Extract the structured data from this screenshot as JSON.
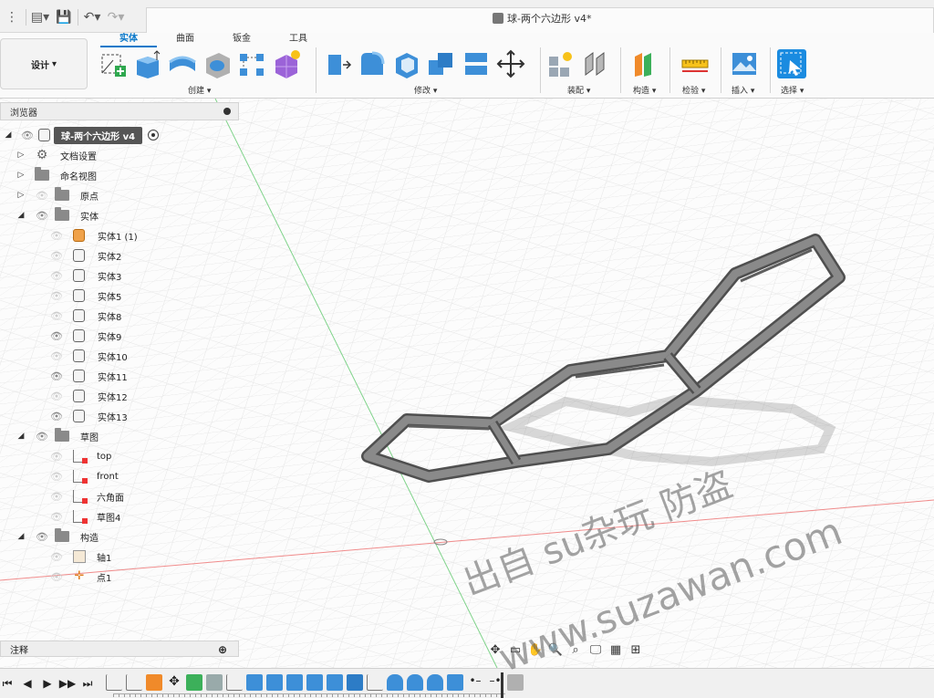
{
  "document": {
    "title": "球-两个六边形 v4*"
  },
  "ribbon": {
    "design_label": "设计",
    "tabs": [
      "实体",
      "曲面",
      "钣金",
      "工具"
    ],
    "active_tab": "实体",
    "groups": {
      "create": "创建",
      "modify": "修改",
      "assemble": "装配",
      "construct": "构造",
      "inspect": "检验",
      "insert": "插入",
      "select": "选择"
    }
  },
  "browser": {
    "title": "浏览器",
    "root": "球-两个六边形 v4",
    "nodes": {
      "doc_settings": "文档设置",
      "named_views": "命名视图",
      "origin": "原点",
      "bodies": "实体",
      "sketches": "草图",
      "construction": "构造"
    },
    "bodies": [
      {
        "label": "实体1 (1)",
        "visible": false,
        "active": true
      },
      {
        "label": "实体2",
        "visible": false
      },
      {
        "label": "实体3",
        "visible": false
      },
      {
        "label": "实体5",
        "visible": false
      },
      {
        "label": "实体8",
        "visible": false
      },
      {
        "label": "实体9",
        "visible": true
      },
      {
        "label": "实体10",
        "visible": false
      },
      {
        "label": "实体11",
        "visible": true
      },
      {
        "label": "实体12",
        "visible": false
      },
      {
        "label": "实体13",
        "visible": true
      }
    ],
    "sketches": [
      "top",
      "front",
      "六角面",
      "草图4"
    ],
    "construction": [
      "轴1",
      "点1"
    ]
  },
  "comments": {
    "title": "注释"
  },
  "watermark": {
    "line1": "出自 su杂玩 防盗",
    "line2": "www.suzawan.com"
  }
}
